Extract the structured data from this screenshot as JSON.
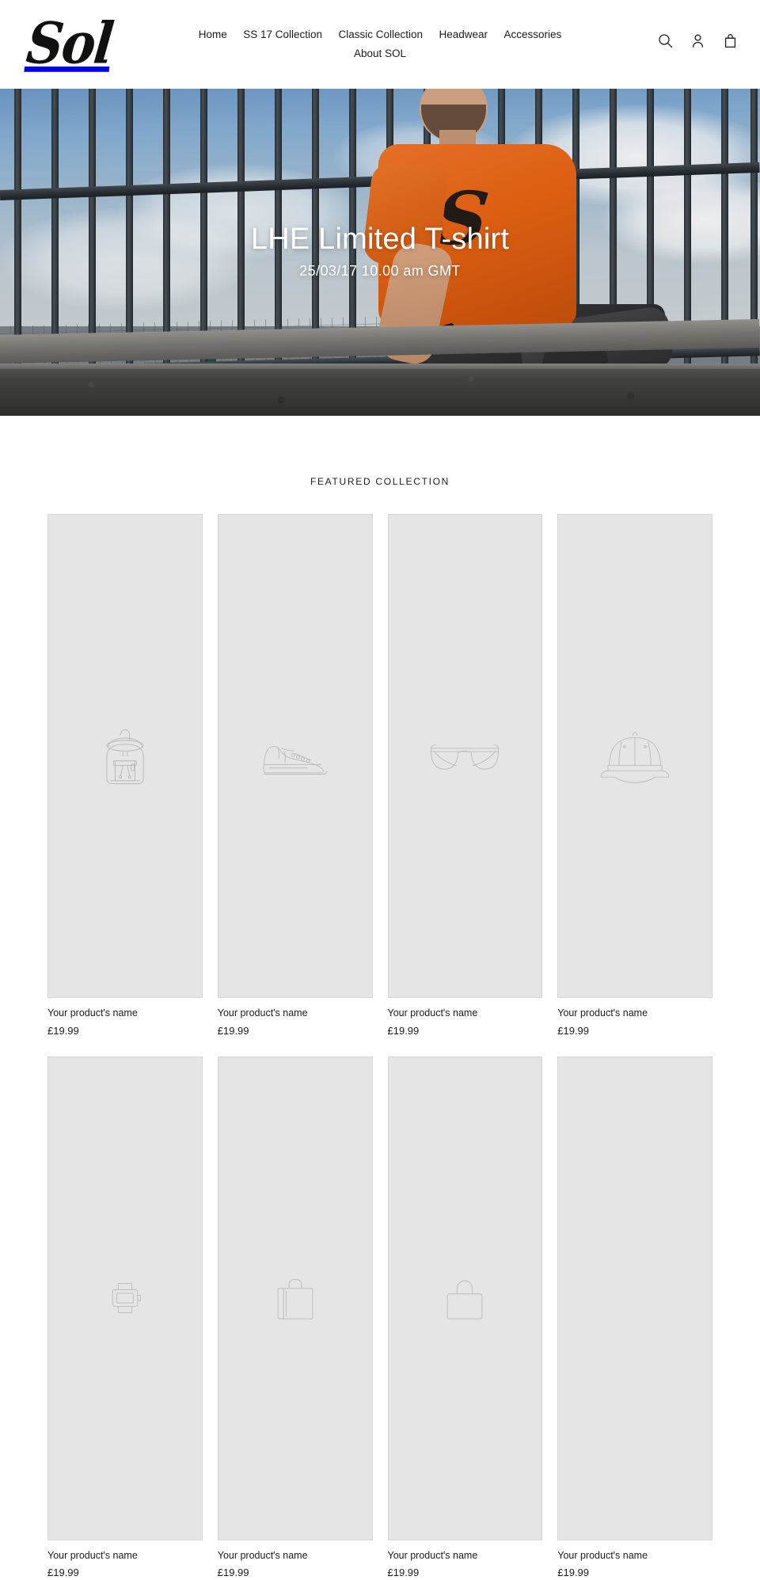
{
  "brand": {
    "logo_text": "Sol",
    "logo_alt": "Sol"
  },
  "header": {
    "nav": [
      {
        "label": "Home"
      },
      {
        "label": "SS 17 Collection"
      },
      {
        "label": "Classic Collection"
      },
      {
        "label": "Headwear"
      },
      {
        "label": "Accessories"
      },
      {
        "label": "About SOL"
      }
    ],
    "icons": [
      {
        "name": "search-icon",
        "label": "Search"
      },
      {
        "name": "account-icon",
        "label": "Log in"
      },
      {
        "name": "cart-icon",
        "label": "Cart"
      }
    ]
  },
  "hero": {
    "title": "LHE Limited T-shirt",
    "subtitle": "25/03/17 10.00 am GMT",
    "shirt_logo_text": "S",
    "colors": {
      "shirt_orange": "#ea6512",
      "sky_blue": "#89b2d8",
      "rail_dark": "#2b3136",
      "wall_grey": "#474745"
    }
  },
  "collection": {
    "title": "FEATURED COLLECTION",
    "row1": [
      {
        "icon": "backpack-icon",
        "name": "Your product's name",
        "price": "£19.99"
      },
      {
        "icon": "sneaker-icon",
        "name": "Your product's name",
        "price": "£19.99"
      },
      {
        "icon": "glasses-icon",
        "name": "Your product's name",
        "price": "£19.99"
      },
      {
        "icon": "cap-icon",
        "name": "Your product's name",
        "price": "£19.99"
      }
    ],
    "row2": [
      {
        "icon": "watch-icon",
        "name": "Your product's name",
        "price": "£19.99"
      },
      {
        "icon": "bag-icon",
        "name": "Your product's name",
        "price": "£19.99"
      },
      {
        "icon": "handbag-icon",
        "name": "Your product's name",
        "price": "£19.99"
      },
      {
        "icon": "blank-icon",
        "name": "Your product's name",
        "price": "£19.99"
      }
    ]
  }
}
